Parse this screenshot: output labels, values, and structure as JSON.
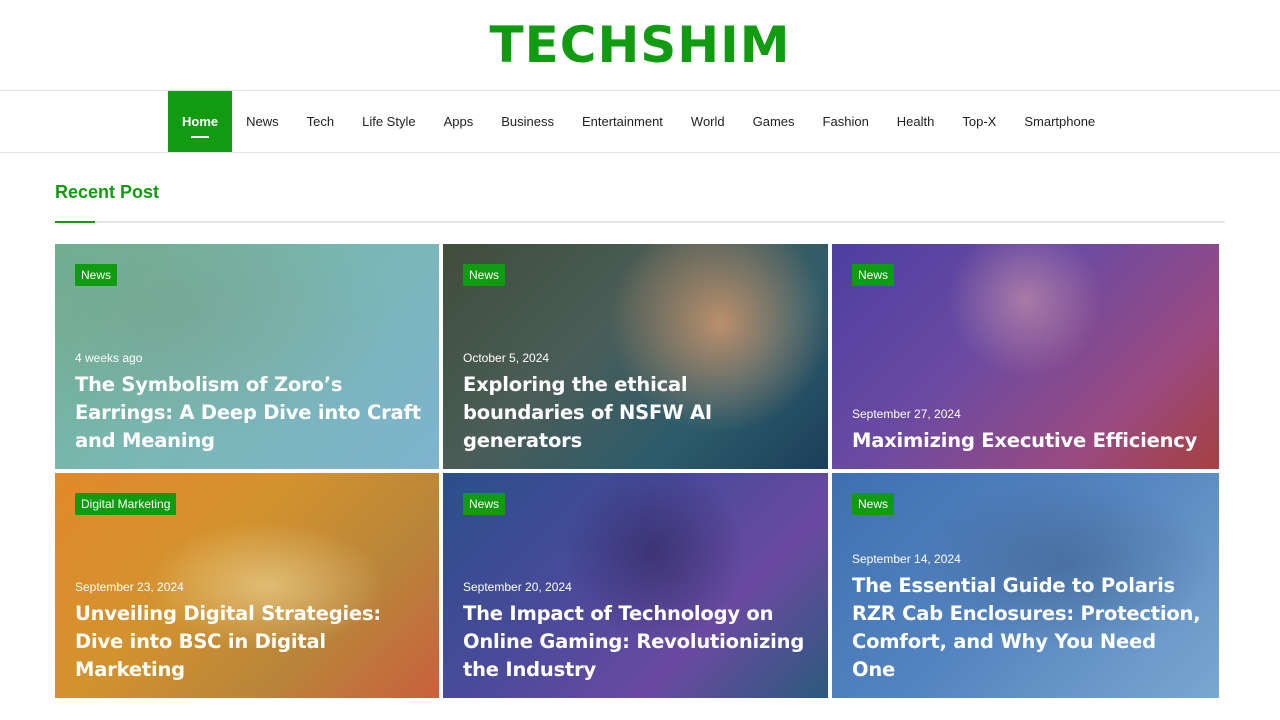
{
  "site": {
    "logo": "TECHSHIM"
  },
  "nav": {
    "items": [
      {
        "label": "Home",
        "active": true
      },
      {
        "label": "News"
      },
      {
        "label": "Tech"
      },
      {
        "label": "Life Style"
      },
      {
        "label": "Apps"
      },
      {
        "label": "Business"
      },
      {
        "label": "Entertainment"
      },
      {
        "label": "World"
      },
      {
        "label": "Games"
      },
      {
        "label": "Fashion"
      },
      {
        "label": "Health"
      },
      {
        "label": "Top-X"
      },
      {
        "label": "Smartphone"
      }
    ]
  },
  "section": {
    "title": "Recent Post"
  },
  "posts": [
    {
      "category": "News",
      "date": "4 weeks ago",
      "title": "The Symbolism of Zoro’s Earrings: A Deep Dive into Craft and Meaning"
    },
    {
      "category": "News",
      "date": "October 5, 2024",
      "title": "Exploring the ethical boundaries of NSFW AI generators"
    },
    {
      "category": "News",
      "date": "September 27, 2024",
      "title": "Maximizing Executive Efficiency"
    },
    {
      "category": "Digital Marketing",
      "date": "September 23, 2024",
      "title": "Unveiling Digital Strategies: Dive into BSC in Digital Marketing"
    },
    {
      "category": "News",
      "date": "September 20, 2024",
      "title": "The Impact of Technology on Online Gaming: Revolutionizing the Industry"
    },
    {
      "category": "News",
      "date": "September 14, 2024",
      "title": "The Essential Guide to Polaris RZR Cab Enclosures: Protection, Comfort, and Why You Need One"
    }
  ],
  "colors": {
    "accent": "#109b10"
  }
}
